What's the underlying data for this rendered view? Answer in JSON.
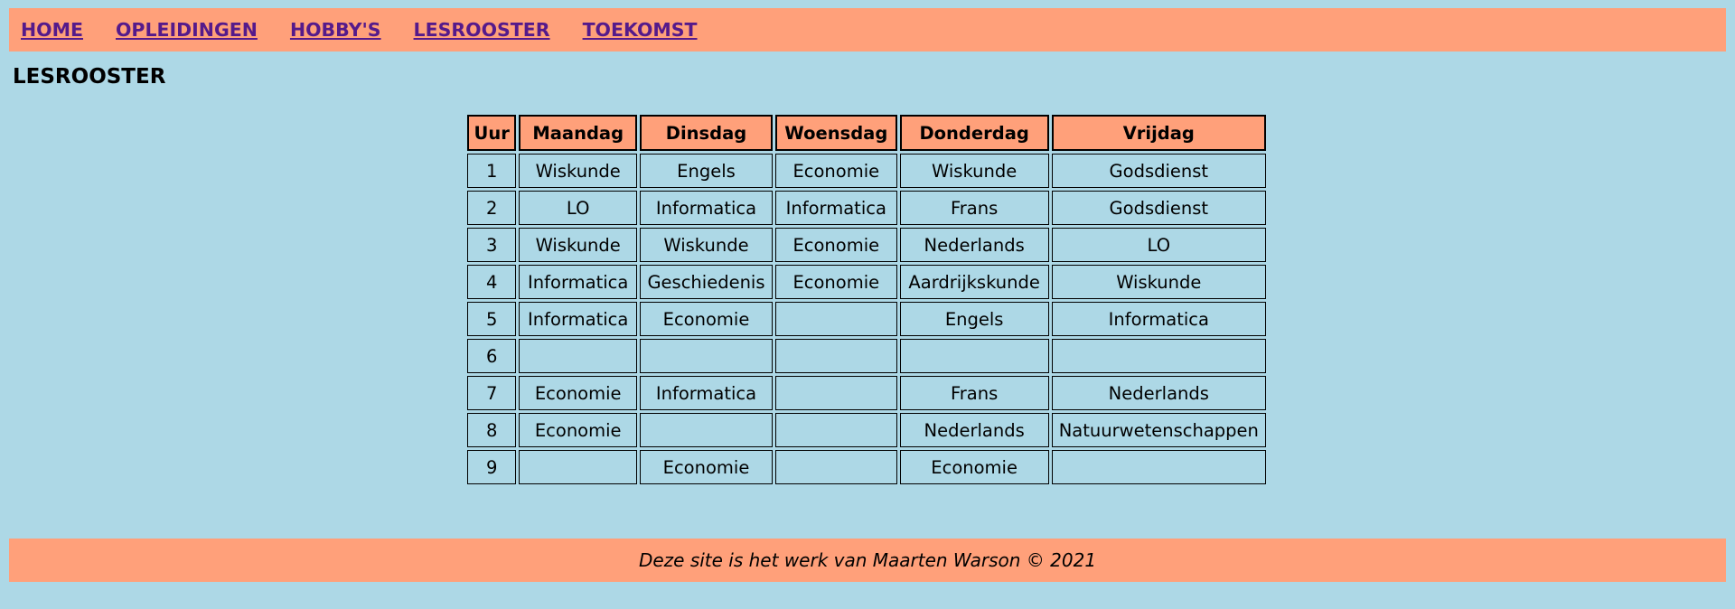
{
  "nav": {
    "items": [
      "HOME",
      "OPLEIDINGEN",
      "HOBBY'S",
      "LESROOSTER",
      "TOEKOMST"
    ]
  },
  "page": {
    "title": "LESROOSTER"
  },
  "schedule": {
    "headers": [
      "Uur",
      "Maandag",
      "Dinsdag",
      "Woensdag",
      "Donderdag",
      "Vrijdag"
    ],
    "rows": [
      [
        "1",
        "Wiskunde",
        "Engels",
        "Economie",
        "Wiskunde",
        "Godsdienst"
      ],
      [
        "2",
        "LO",
        "Informatica",
        "Informatica",
        "Frans",
        "Godsdienst"
      ],
      [
        "3",
        "Wiskunde",
        "Wiskunde",
        "Economie",
        "Nederlands",
        "LO"
      ],
      [
        "4",
        "Informatica",
        "Geschiedenis",
        "Economie",
        "Aardrijkskunde",
        "Wiskunde"
      ],
      [
        "5",
        "Informatica",
        "Economie",
        "",
        "Engels",
        "Informatica"
      ],
      [
        "6",
        "",
        "",
        "",
        "",
        ""
      ],
      [
        "7",
        "Economie",
        "Informatica",
        "",
        "Frans",
        "Nederlands"
      ],
      [
        "8",
        "Economie",
        "",
        "",
        "Nederlands",
        "Natuurwetenschappen"
      ],
      [
        "9",
        "",
        "Economie",
        "",
        "Economie",
        ""
      ]
    ]
  },
  "footer": {
    "text": "Deze site is het werk van Maarten Warson © 2021"
  },
  "colors": {
    "background": "#add8e6",
    "accent": "#ffa07a",
    "link": "#551a8b"
  }
}
